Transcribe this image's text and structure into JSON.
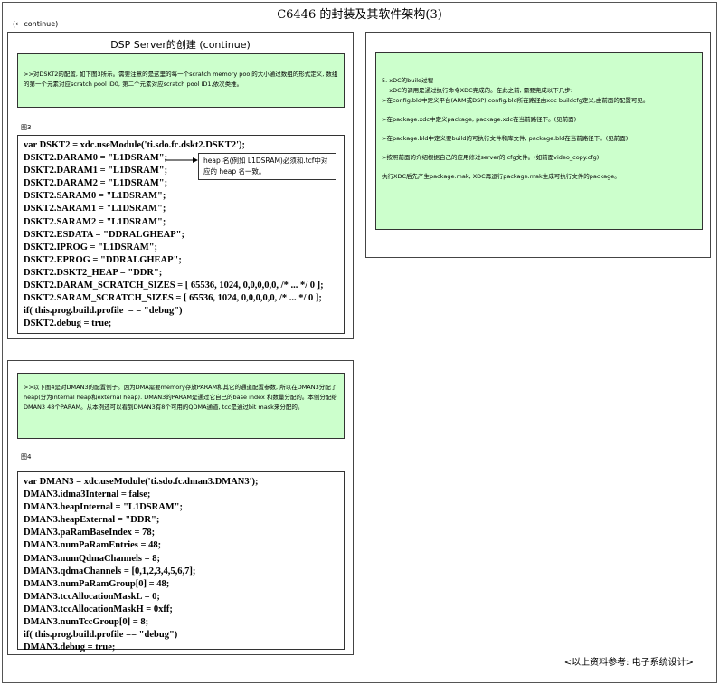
{
  "header": {
    "title": "C6446   的封装及其软件架构(3)",
    "back_link": "(← continue)"
  },
  "panel_dskt2": {
    "title": "DSP Server的创建 (continue)",
    "note": ">>对DSKT2的配置, 如下图3所示。需要注意的是这里的每一个scratch memory pool的大小通过数组的形式定义, 数组的第一个元素对应scratch pool ID0, 第二个元素对应scratch pool ID1,依次类推。",
    "figure_label": "图3",
    "code": [
      "var DSKT2 = xdc.useModule('ti.sdo.fc.dskt2.DSKT2');",
      "DSKT2.DARAM0 = \"L1DSRAM\";",
      "DSKT2.DARAM1 = \"L1DSRAM\";",
      "DSKT2.DARAM2 = \"L1DSRAM\";",
      "DSKT2.SARAM0 = \"L1DSRAM\";",
      "DSKT2.SARAM1 = \"L1DSRAM\";",
      "DSKT2.SARAM2 = \"L1DSRAM\";",
      "DSKT2.ESDATA = \"DDRALGHEAP\";",
      "DSKT2.IPROG = \"L1DSRAM\";",
      "DSKT2.EPROG = \"DDRALGHEAP\";",
      "DSKT2.DSKT2_HEAP = \"DDR\";",
      "DSKT2.DARAM_SCRATCH_SIZES = [ 65536, 1024, 0,0,0,0,0, /* ... */ 0 ];",
      "DSKT2.SARAM_SCRATCH_SIZES = [ 65536, 1024, 0,0,0,0,0, /* ... */ 0 ];",
      "if( this.prog.build.profile  = = \"debug\")",
      "DSKT2.debug = true;"
    ],
    "callout": "heap 名(例如 L1DSRAM)必须和.tcf中对应的 heap 名一致。"
  },
  "panel_build": {
    "items": [
      "5. xDC的build过程\n    xDC的调用是通过执行命令XDC完成的。在此之前, 需要完成以下几步:\n>在config.bld中定义平台(ARM或DSP),config.bld所在路径由xdc buildcfg定义,由前面的配置可见。",
      ">在package.xdc中定义package, package.xdc在当前路径下。(见前面)",
      ">在package.bld中定义要build的可执行文件和库文件, package.bld在当前路径下。(见前面)",
      ">按照前面的介绍根据自己的应用修过server的.cfg文件。(如前面video_copy.cfg)",
      "执行XDC后先产生package.mak, XDC再运行package.mak生成可执行文件的package。"
    ]
  },
  "panel_dman3": {
    "note": ">>以下图4是对DMAN3的配置例子。因为DMA需要memory存放PARAM和其它的通道配置参数, 所以在DMAN3分配了heap(分为internal heap和external heap). DMAN3的PARAM是通过它自己的base index 和数量分配的。本例分配给DMAN3 48个PARAM。从本例还可以看到DMAN3有8个可用的QDMA通道, tcc是通过bit mask来分配的。",
    "figure_label": "图4",
    "code": [
      "var DMAN3 = xdc.useModule('ti.sdo.fc.dman3.DMAN3');",
      "DMAN3.idma3Internal = false;",
      "DMAN3.heapInternal = \"L1DSRAM\";",
      "DMAN3.heapExternal = \"DDR\";",
      "DMAN3.paRamBaseIndex = 78;",
      "DMAN3.numPaRamEntries = 48;",
      "DMAN3.numQdmaChannels = 8;",
      "DMAN3.qdmaChannels = [0,1,2,3,4,5,6,7];",
      "DMAN3.numPaRamGroup[0] = 48;",
      "DMAN3.tccAllocationMaskL = 0;",
      "DMAN3.tccAllocationMaskH = 0xff;",
      "DMAN3.numTccGroup[0] = 8;",
      "if( this.prog.build.profile == \"debug\")",
      "DMAN3.debug = true;"
    ]
  },
  "footer": "<以上资料参考: 电子系统设计>"
}
